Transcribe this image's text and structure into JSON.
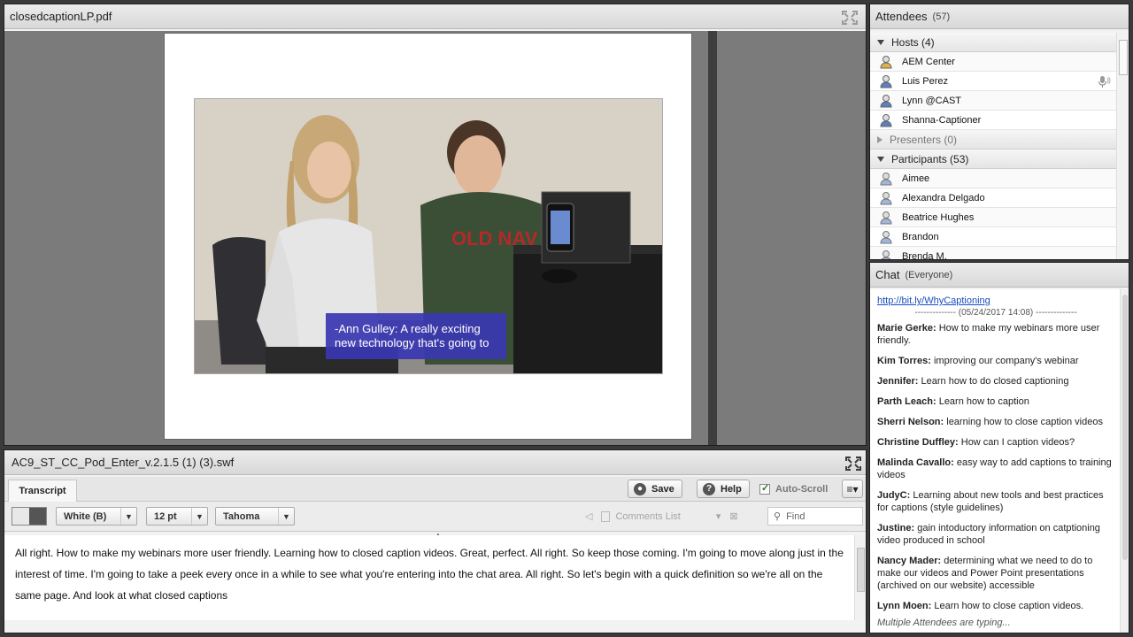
{
  "share_pod": {
    "title": "closedcaptionLP.pdf",
    "caption_line1": "-Ann Gulley: A really exciting",
    "caption_line2": "new technology that's going to",
    "shirt_text": "OLD NAV"
  },
  "attendees": {
    "title": "Attendees",
    "count": "(57)",
    "hosts_label": "Hosts (4)",
    "hosts": [
      "AEM  Center",
      "Luis Perez",
      "Lynn @CAST",
      "Shanna-Captioner"
    ],
    "presenters_label": "Presenters (0)",
    "participants_label": "Participants (53)",
    "participants": [
      "Aimee",
      "Alexandra Delgado",
      "Beatrice Hughes",
      "Brandon",
      "Brenda M."
    ]
  },
  "chat": {
    "title": "Chat",
    "scope": "(Everyone)",
    "link": "http://bit.ly/WhyCaptioning",
    "date": "-------------- (05/24/2017 14:08) --------------",
    "messages": [
      {
        "who": "Marie Gerke:",
        "text": " How to make my webinars more user friendly."
      },
      {
        "who": "Kim Torres:",
        "text": " improving our company's webinar"
      },
      {
        "who": "Jennifer:",
        "text": " Learn how to do closed captioning"
      },
      {
        "who": "Parth Leach:",
        "text": " Learn how to caption"
      },
      {
        "who": "Sherri Nelson:",
        "text": " learning how to close caption videos"
      },
      {
        "who": "Christine Duffley:",
        "text": " How can I caption videos?"
      },
      {
        "who": "Malinda Cavallo:",
        "text": " easy way to add captions to training videos"
      },
      {
        "who": "JudyC:",
        "text": " Learning about new tools and best practices for captions (style guidelines)"
      },
      {
        "who": "Justine:",
        "text": " gain intoductory information on catptioning video produced in school"
      },
      {
        "who": "Nancy Mader:",
        "text": " determining what we need to do to make our videos and Power Point presentations (archived on our website) accessible"
      },
      {
        "who": "Lynn Moen:",
        "text": " Learn how to close caption videos."
      }
    ],
    "typing": "Multiple Attendees are typing..."
  },
  "caption_pod": {
    "title": "AC9_ST_CC_Pod_Enter_v.2.1.5 (1) (3).swf",
    "tab": "Transcript",
    "save": "Save",
    "help": "Help",
    "autoscroll": "Auto-Scroll",
    "color_select": "White (B)",
    "size_select": "12 pt",
    "font_select": "Tahoma",
    "comments_list": "Comments List",
    "find_placeholder": "Find",
    "transcript": "All right. How to make my webinars more user friendly. Learning how to closed caption videos. Great, perfect. All right. So keep those coming. I'm going to move along just in the interest of time. I'm going to take a peek every once in a while to see what you're entering into the chat area. All right. So let's begin with a quick definition so we're all on the same page. And look at what closed captions"
  }
}
